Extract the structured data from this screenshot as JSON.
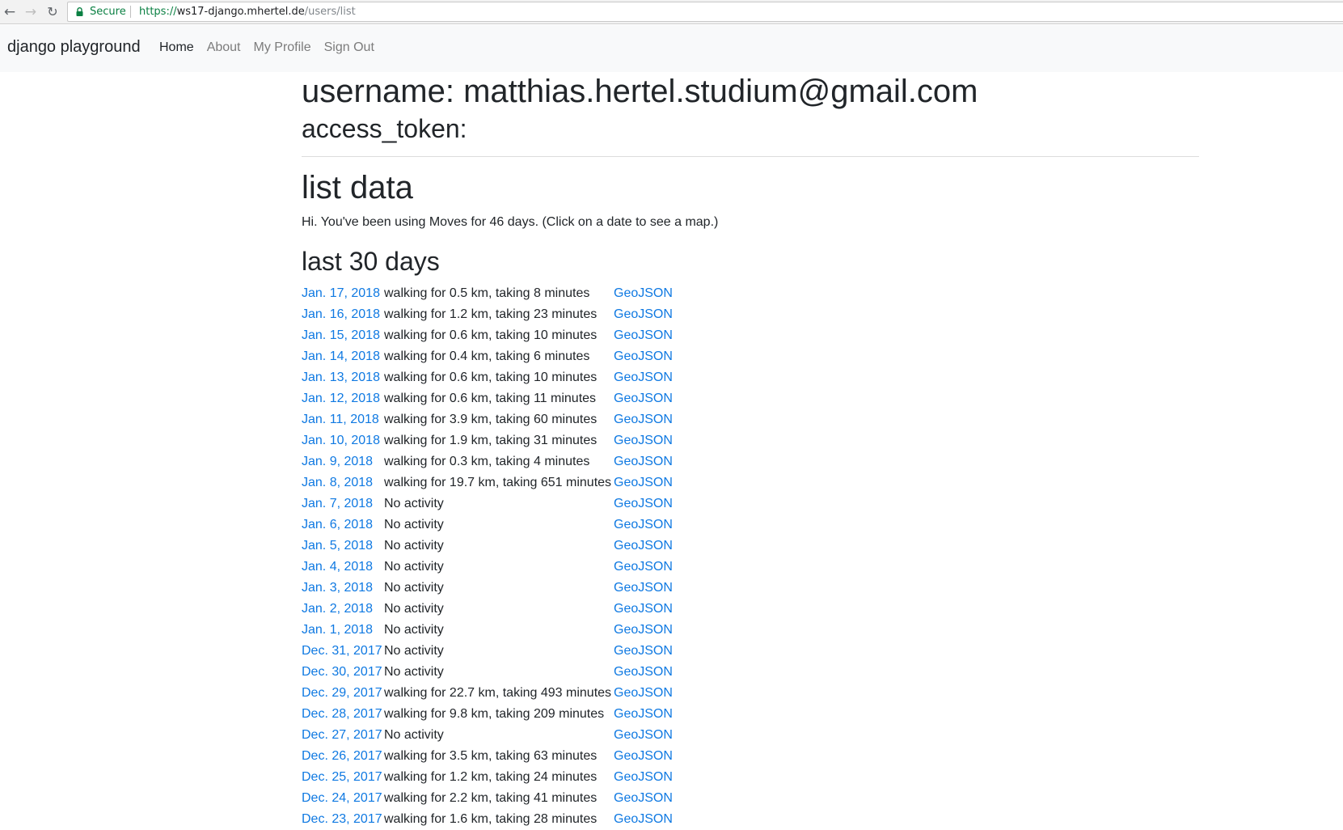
{
  "browser": {
    "secure_label": "Secure",
    "url_scheme": "https://",
    "url_host": "ws17-django.mhertel.de",
    "url_path": "/users/list"
  },
  "navbar": {
    "brand": "django playground",
    "links": [
      {
        "label": "Home",
        "active": true
      },
      {
        "label": "About",
        "active": false
      },
      {
        "label": "My Profile",
        "active": false
      },
      {
        "label": "Sign Out",
        "active": false
      }
    ]
  },
  "main": {
    "username_line": "username: matthias.hertel.studium@gmail.com",
    "access_token_line": "access_token:",
    "list_heading": "list data",
    "intro": "Hi. You've been using Moves for 46 days. (Click on a date to see a map.)",
    "days_heading": "last 30 days",
    "geojson_label": "GeoJSON",
    "rows": [
      {
        "date": "Jan. 17, 2018",
        "activity": "walking for 0.5 km, taking 8 minutes"
      },
      {
        "date": "Jan. 16, 2018",
        "activity": "walking for 1.2 km, taking 23 minutes"
      },
      {
        "date": "Jan. 15, 2018",
        "activity": "walking for 0.6 km, taking 10 minutes"
      },
      {
        "date": "Jan. 14, 2018",
        "activity": "walking for 0.4 km, taking 6 minutes"
      },
      {
        "date": "Jan. 13, 2018",
        "activity": "walking for 0.6 km, taking 10 minutes"
      },
      {
        "date": "Jan. 12, 2018",
        "activity": "walking for 0.6 km, taking 11 minutes"
      },
      {
        "date": "Jan. 11, 2018",
        "activity": "walking for 3.9 km, taking 60 minutes"
      },
      {
        "date": "Jan. 10, 2018",
        "activity": "walking for 1.9 km, taking 31 minutes"
      },
      {
        "date": "Jan. 9, 2018",
        "activity": "walking for 0.3 km, taking 4 minutes"
      },
      {
        "date": "Jan. 8, 2018",
        "activity": "walking for 19.7 km, taking 651 minutes"
      },
      {
        "date": "Jan. 7, 2018",
        "activity": "No activity"
      },
      {
        "date": "Jan. 6, 2018",
        "activity": "No activity"
      },
      {
        "date": "Jan. 5, 2018",
        "activity": "No activity"
      },
      {
        "date": "Jan. 4, 2018",
        "activity": "No activity"
      },
      {
        "date": "Jan. 3, 2018",
        "activity": "No activity"
      },
      {
        "date": "Jan. 2, 2018",
        "activity": "No activity"
      },
      {
        "date": "Jan. 1, 2018",
        "activity": "No activity"
      },
      {
        "date": "Dec. 31, 2017",
        "activity": "No activity"
      },
      {
        "date": "Dec. 30, 2017",
        "activity": "No activity"
      },
      {
        "date": "Dec. 29, 2017",
        "activity": "walking for 22.7 km, taking 493 minutes"
      },
      {
        "date": "Dec. 28, 2017",
        "activity": "walking for 9.8 km, taking 209 minutes"
      },
      {
        "date": "Dec. 27, 2017",
        "activity": "No activity"
      },
      {
        "date": "Dec. 26, 2017",
        "activity": "walking for 3.5 km, taking 63 minutes"
      },
      {
        "date": "Dec. 25, 2017",
        "activity": "walking for 1.2 km, taking 24 minutes"
      },
      {
        "date": "Dec. 24, 2017",
        "activity": "walking for 2.2 km, taking 41 minutes"
      },
      {
        "date": "Dec. 23, 2017",
        "activity": "walking for 1.6 km, taking 28 minutes"
      }
    ]
  }
}
